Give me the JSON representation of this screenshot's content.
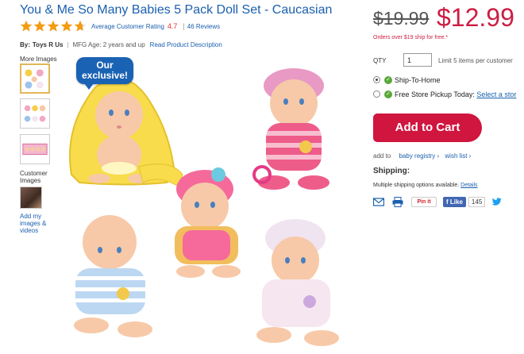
{
  "product": {
    "title": "You & Me So Many Babies 5 Pack Doll Set - Caucasian",
    "rating_label": "Average Customer Rating",
    "rating_value": "4.7",
    "rating_fraction": 0.94,
    "reviews": "46 Reviews",
    "by_label": "By:",
    "brand": "Toys R Us",
    "mfg_age": "MFG Age: 2 years and up",
    "desc_link": "Read Product Description"
  },
  "gallery": {
    "more_images_label": "More Images",
    "badge": "Our exclusive!",
    "customer_images_label": "Customer Images",
    "add_images_link": "Add my images & videos"
  },
  "pricing": {
    "old_price": "$19.99",
    "new_price": "$12.99",
    "ship_free": "Orders over $19 ship for free.*"
  },
  "purchase": {
    "qty_label": "QTY",
    "qty_value": "1",
    "qty_limit": "Limit 5 items per customer",
    "ship_to_home": "Ship-To-Home",
    "store_pickup": "Free Store Pickup Today:",
    "select_store": "Select a stor",
    "add_to_cart": "Add to Cart",
    "add_to_label": "add to",
    "baby_registry": "baby registry ›",
    "wish_list": "wish list ›"
  },
  "shipping": {
    "heading": "Shipping:",
    "text": "Multiple shipping options available.",
    "details_link": "Details"
  },
  "share": {
    "pinit": "Pin it",
    "fb_like": "Like",
    "fb_count": "145",
    "icons": [
      "email-icon",
      "print-icon",
      "pinterest-icon",
      "facebook-icon",
      "twitter-icon"
    ]
  },
  "colors": {
    "link": "#1a5fae",
    "price": "#cc1e42",
    "cart": "#d0153f",
    "badge": "#1a62b4",
    "star": "#f39c12"
  }
}
